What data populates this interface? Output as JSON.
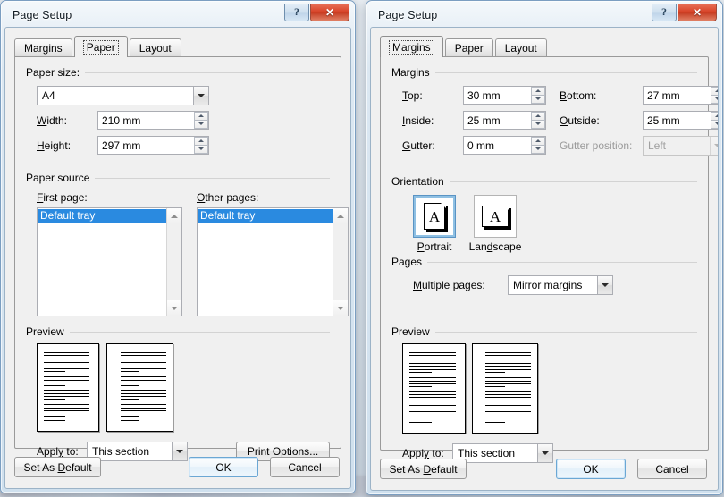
{
  "window_title": "Page Setup",
  "window_buttons": {
    "help": "?",
    "close": "✕",
    "help_icon": "help-icon",
    "close_icon": "close-icon"
  },
  "colors": {
    "selection_blue": "#2a8ae0",
    "close_red": "#d9472c",
    "default_button_blue": "#6ba7d4",
    "dialog_face": "#f0f0f0"
  },
  "dialog_paper": {
    "title": "Page Setup",
    "tabs": [
      {
        "label": "Margins",
        "active": false
      },
      {
        "label": "Paper",
        "active": true
      },
      {
        "label": "Layout",
        "active": false
      }
    ],
    "paper_size": {
      "group_title": "Paper size:",
      "size_value": "A4",
      "width_label": "Width:",
      "width_value": "210 mm",
      "height_label": "Height:",
      "height_value": "297 mm"
    },
    "paper_source": {
      "group_title": "Paper source",
      "first_page_label": "First page:",
      "first_page_items": [
        "Default tray"
      ],
      "first_page_selected": "Default tray",
      "other_pages_label": "Other pages:",
      "other_pages_items": [
        "Default tray"
      ],
      "other_pages_selected": "Default tray"
    },
    "preview": {
      "group_title": "Preview",
      "apply_to_label": "Apply to:",
      "apply_to_value": "This section",
      "print_options_label": "Print Options..."
    },
    "footer": {
      "set_as_default": "Set As Default",
      "ok": "OK",
      "cancel": "Cancel"
    }
  },
  "dialog_margins": {
    "title": "Page Setup",
    "tabs": [
      {
        "label": "Margins",
        "active": true
      },
      {
        "label": "Paper",
        "active": false
      },
      {
        "label": "Layout",
        "active": false
      }
    ],
    "margins": {
      "group_title": "Margins",
      "fields": [
        {
          "label": "Top:",
          "value": "30 mm",
          "disabled": false
        },
        {
          "label": "Bottom:",
          "value": "27 mm",
          "disabled": false
        },
        {
          "label": "Inside:",
          "value": "25 mm",
          "disabled": false
        },
        {
          "label": "Outside:",
          "value": "25 mm",
          "disabled": false
        },
        {
          "label": "Gutter:",
          "value": "0 mm",
          "disabled": false
        },
        {
          "label": "Gutter position:",
          "value": "Left",
          "disabled": true
        }
      ]
    },
    "orientation": {
      "group_title": "Orientation",
      "options": [
        {
          "label": "Portrait",
          "selected": true,
          "glyph": "A"
        },
        {
          "label": "Landscape",
          "selected": false,
          "glyph": "A"
        }
      ]
    },
    "pages": {
      "group_title": "Pages",
      "multiple_pages_label": "Multiple pages:",
      "multiple_pages_value": "Mirror margins"
    },
    "preview": {
      "group_title": "Preview",
      "apply_to_label": "Apply to:",
      "apply_to_value": "This section"
    },
    "footer": {
      "set_as_default": "Set As Default",
      "ok": "OK",
      "cancel": "Cancel"
    }
  }
}
